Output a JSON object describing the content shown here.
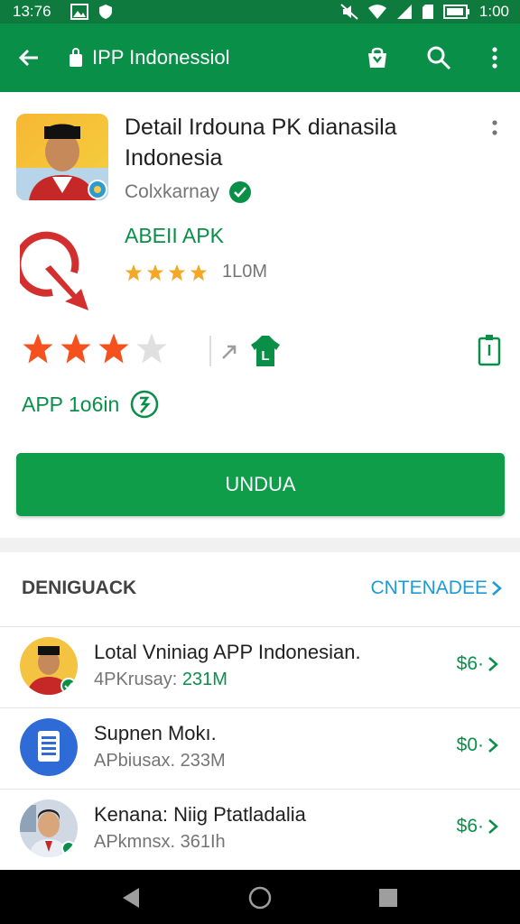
{
  "status_bar": {
    "time": "13:76",
    "battery_time": "1:00"
  },
  "app_bar": {
    "title": "IPP Indonessiol"
  },
  "app": {
    "title": "Detail Irdouna PK dianasila Indonesia",
    "developer": "Colxkarnay",
    "badge_label": "ABEII APK",
    "small_rating_count": "1L0M",
    "rating": 3,
    "app_info_label": "APP 1o6in",
    "install_label": "UNDUA"
  },
  "related": {
    "section_title": "DENIGUACK",
    "see_more": "CNTENADEE",
    "items": [
      {
        "title": "Lotal Vniniag APP Indonesian.",
        "sub_prefix": "4PKrusay:",
        "sub_value": "231M",
        "price": "$6·"
      },
      {
        "title": "Supnen Mokı.",
        "sub_prefix": "APbiusax.",
        "sub_value": "233M",
        "price": "$0·"
      },
      {
        "title": "Kenana: Niig Ptatladalia",
        "sub_prefix": "APkmnsx.",
        "sub_value": "361Ih",
        "price": "$6·"
      }
    ]
  },
  "colors": {
    "accent": "#0a8f49",
    "status_bar": "#0f7a3e",
    "link": "#1e9bd7",
    "star_big": "#f4511e",
    "star_small": "#f4a825"
  }
}
